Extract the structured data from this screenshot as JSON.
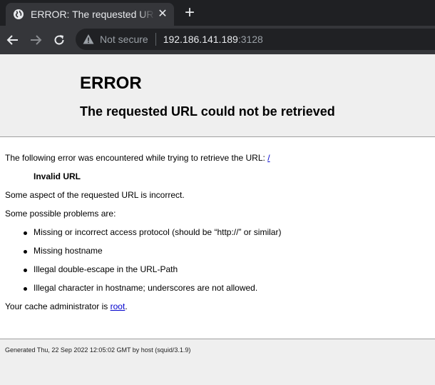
{
  "browser": {
    "tab_title": "ERROR: The requested URL could not be retrieved",
    "tab_close_glyph": "✕",
    "new_tab_glyph": "+",
    "security_label": "Not secure",
    "url_host": "192.186.141.189",
    "url_port": ":3128"
  },
  "page": {
    "heading": "ERROR",
    "subheading": "The requested URL could not be retrieved",
    "intro_text": "The following error was encountered while trying to retrieve the URL: ",
    "intro_link": "/",
    "error_name": "Invalid URL",
    "error_description": "Some aspect of the requested URL is incorrect.",
    "problems_label": "Some possible problems are:",
    "problems": [
      "Missing or incorrect access protocol (should be “http://” or similar)",
      "Missing hostname",
      "Illegal double-escape in the URL-Path",
      "Illegal character in hostname; underscores are not allowed."
    ],
    "admin_text": "Your cache administrator is ",
    "admin_link": "root",
    "admin_suffix": ".",
    "footer": "Generated Thu, 22 Sep 2022 12:05:02 GMT by host (squid/3.1.9)"
  },
  "colors": {
    "chrome_dark": "#1f2023",
    "chrome_tab": "#35363a",
    "omnibox": "#202124",
    "page_header_bg": "#efefef",
    "link": "#0000cc"
  }
}
